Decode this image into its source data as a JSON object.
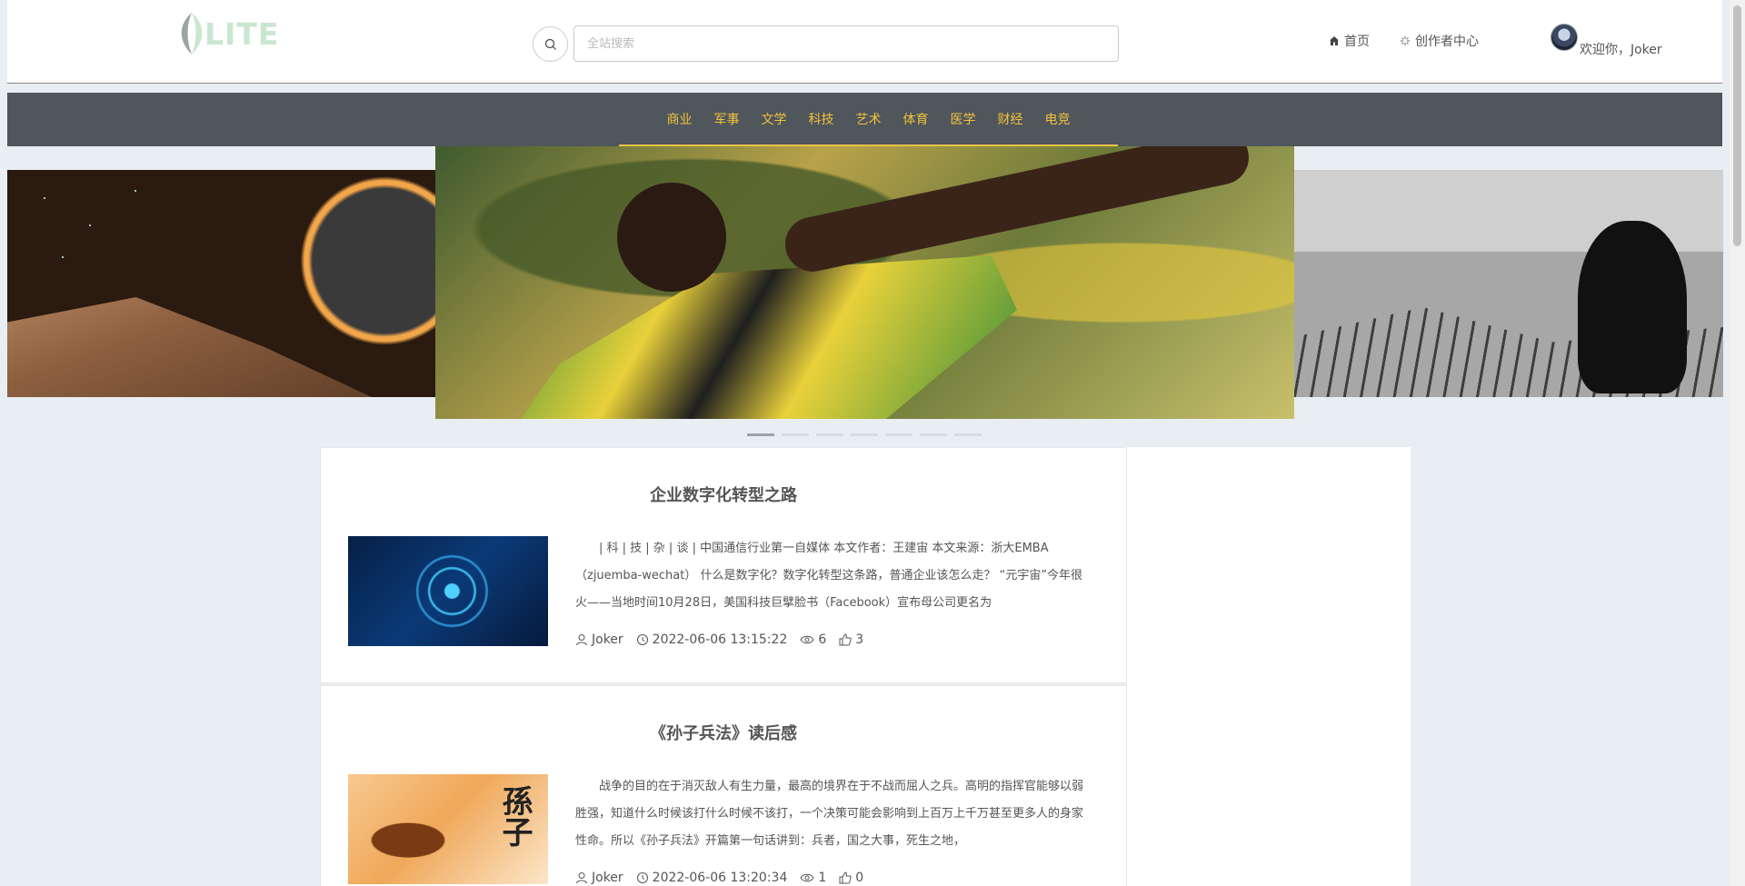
{
  "header": {
    "logo_text": "LITE",
    "search": {
      "placeholder": "全站搜索",
      "value": ""
    },
    "nav": [
      {
        "label": "首页",
        "icon": "home-icon"
      },
      {
        "label": "创作者中心",
        "icon": "spark-icon"
      }
    ],
    "welcome": "欢迎你，Joker"
  },
  "categories": [
    "商业",
    "军事",
    "文学",
    "科技",
    "艺术",
    "体育",
    "医学",
    "财经",
    "电竞"
  ],
  "carousel": {
    "slide_count": 7,
    "active_index": 0
  },
  "articles": [
    {
      "title": "企业数字化转型之路",
      "excerpt": "| 科 | 技 | 杂 | 谈 | 中国通信行业第一自媒体 本文作者：王建宙 本文来源：浙大EMBA（zjuemba-wechat） 什么是数字化？数字化转型这条路，普通企业该怎么走？ “元宇宙”今年很火——当地时间10月28日，美国科技巨擘脸书（Facebook）宣布母公司更名为",
      "author": "Joker",
      "time": "2022-06-06 13:15:22",
      "views": "6",
      "likes": "3",
      "thumb": "tech"
    },
    {
      "title": "《孙子兵法》读后感",
      "excerpt": "战争的目的在于消灭敌人有生力量，最高的境界在于不战而屈人之兵。高明的指挥官能够以弱胜强，知道什么时候该打什么时候不该打，一个决策可能会影响到上百万上千万甚至更多人的身家性命。所以《孙子兵法》开篇第一句话讲到：兵者，国之大事，死生之地，",
      "author": "Joker",
      "time": "2022-06-06 13:20:34",
      "views": "1",
      "likes": "0",
      "thumb": "sun",
      "thumb_glyph": "孫子"
    }
  ],
  "colors": {
    "category_bar": "#4f565c",
    "category_text": "#f2c13c",
    "page_bg": "#e9eef3"
  }
}
